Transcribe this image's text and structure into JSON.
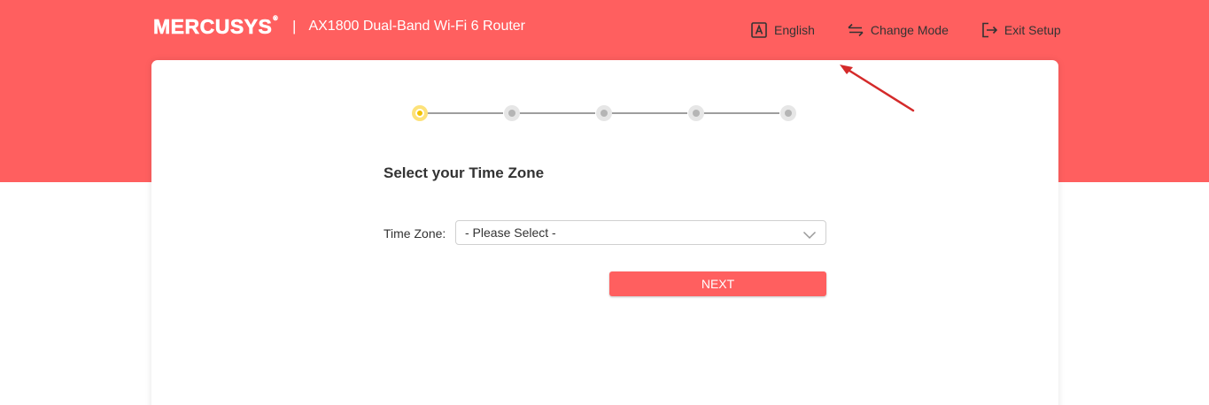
{
  "header": {
    "logo": "MERCUSYS",
    "logo_tm": "®",
    "separator": "|",
    "product": "AX1800 Dual-Band Wi-Fi 6 Router"
  },
  "nav": {
    "language": {
      "icon": "language-icon",
      "label": "English"
    },
    "change_mode": {
      "icon": "swap-icon",
      "label": "Change Mode"
    },
    "exit_setup": {
      "icon": "exit-icon",
      "label": "Exit Setup"
    }
  },
  "stepper": {
    "total_steps": 5,
    "current_step": 1
  },
  "main": {
    "title": "Select your Time Zone",
    "time_zone_label": "Time Zone:",
    "time_zone_value": "- Please Select -",
    "next_label": "NEXT"
  },
  "colors": {
    "brand": "#ff5f5f",
    "active_step": "#f2c200",
    "annotation": "#d42a2a"
  }
}
